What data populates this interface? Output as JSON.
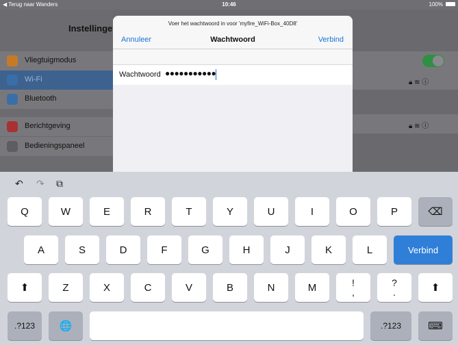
{
  "status_bar": {
    "back_label": "◀ Terug naar Wanders",
    "time": "10:46",
    "battery": "100%"
  },
  "settings": {
    "title": "Instellingen",
    "items": [
      {
        "label": "Vliegtuigmodus",
        "icon": "airplane-icon",
        "color": "#c77a26"
      },
      {
        "label": "Wi-Fi",
        "icon": "wifi-icon",
        "color": "#3a6ea8"
      },
      {
        "label": "Bluetooth",
        "icon": "bluetooth-icon",
        "color": "#3a6ea8"
      },
      {
        "label": "Berichtgeving",
        "icon": "notification-icon",
        "color": "#a83232"
      },
      {
        "label": "Bedieningspaneel",
        "icon": "control-center-icon",
        "color": "#5e5e62"
      }
    ],
    "airplane_toggle_on": true
  },
  "modal": {
    "prompt": "Voer het wachtwoord in voor 'myfire_WiFi-Box_40D8'",
    "cancel_label": "Annuleer",
    "title": "Wachtwoord",
    "join_label": "Verbind",
    "field_label": "Wachtwoord",
    "field_value": "●●●●●●●●●●●"
  },
  "keyboard": {
    "undo": "↶",
    "redo": "↷",
    "paste": "⧉",
    "row1": [
      "Q",
      "W",
      "E",
      "R",
      "T",
      "Y",
      "U",
      "I",
      "O",
      "P"
    ],
    "delete": "⌫",
    "row2": [
      "A",
      "S",
      "D",
      "F",
      "G",
      "H",
      "J",
      "K",
      "L"
    ],
    "return_label": "Verbind",
    "shift": "⬆",
    "row3": [
      "Z",
      "X",
      "C",
      "V",
      "B",
      "N",
      "M"
    ],
    "punct1_top": "!",
    "punct1_bottom": ",",
    "punct2_top": "?",
    "punct2_bottom": ".",
    "numbers_label": ".?123",
    "globe": "🌐",
    "hide_keyboard": "⌨"
  }
}
